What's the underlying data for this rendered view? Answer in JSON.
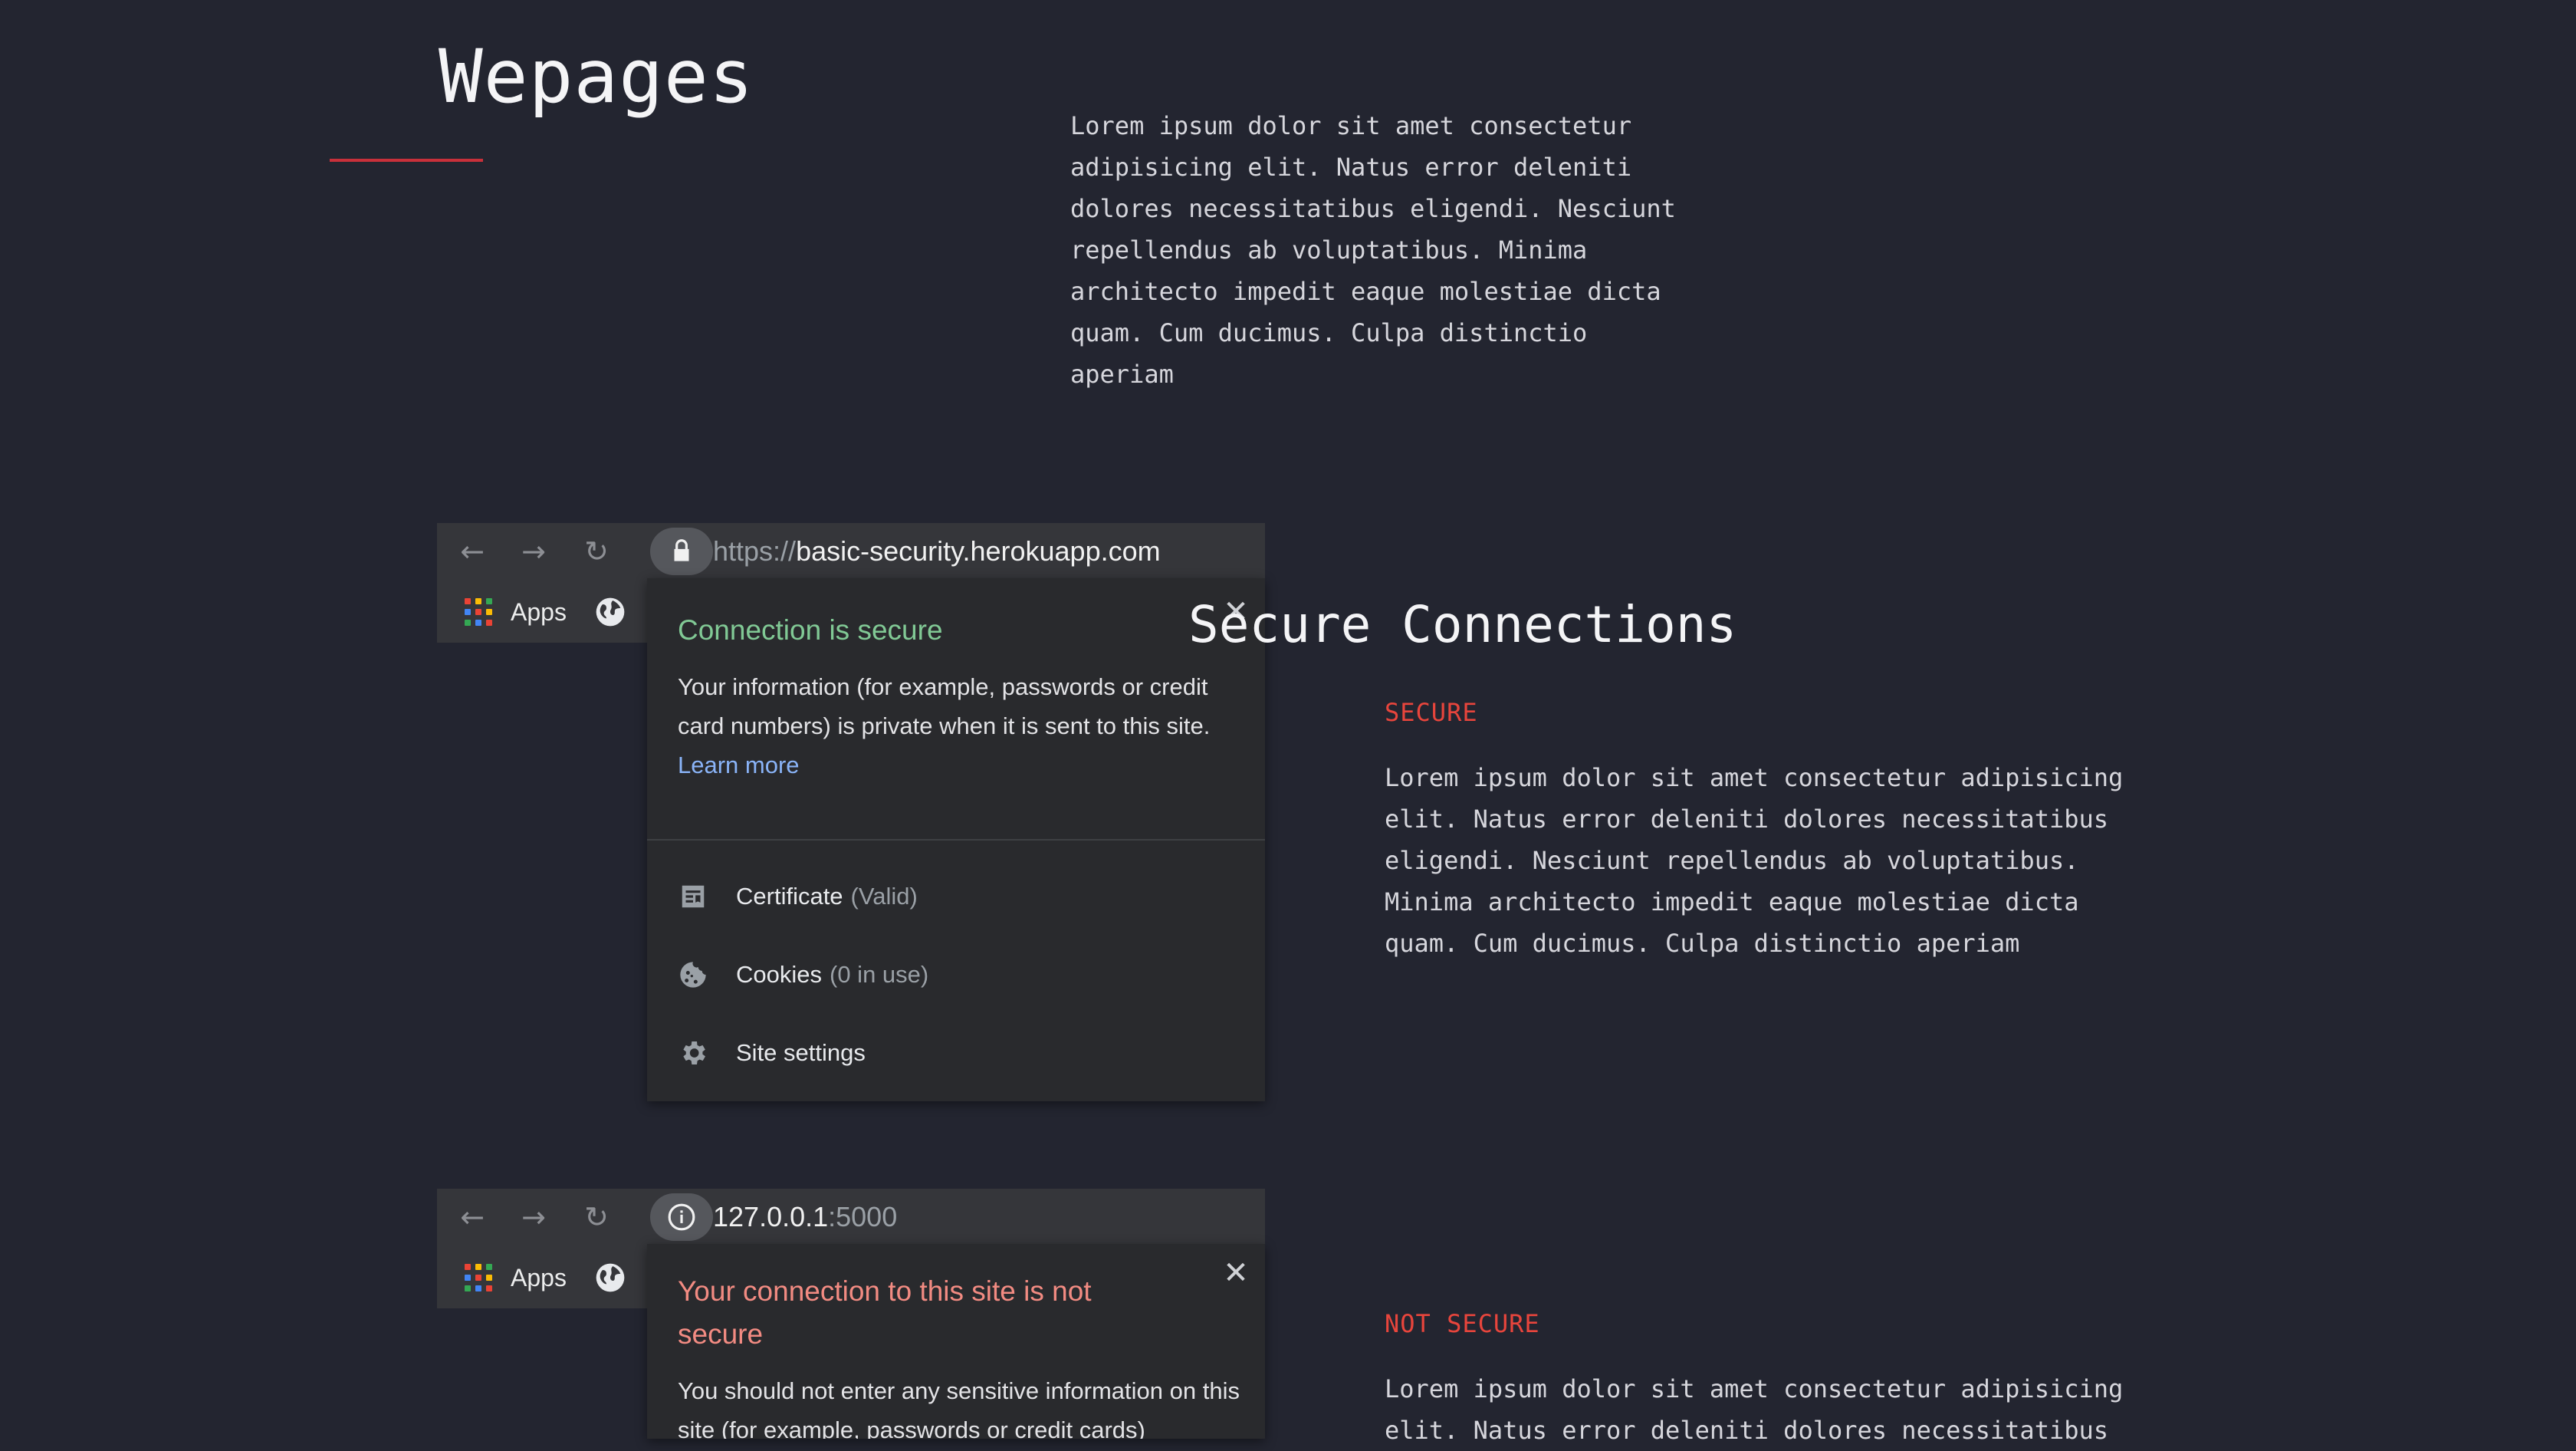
{
  "header": {
    "title": "Wepages",
    "intro": "Lorem ipsum dolor sit amet consectetur adipisicing elit. Natus error deleniti dolores necessitatibus eligendi. Nesciunt repellendus ab voluptatibus. Minima architecto impedit eaque molestiae dicta quam. Cum ducimus. Culpa distinctio aperiam"
  },
  "browser": {
    "back_glyph": "←",
    "forward_glyph": "→",
    "reload_glyph": "↻",
    "apps_label": "Apps",
    "icons": [
      "back-icon",
      "forward-icon",
      "reload-icon",
      "lock-icon",
      "info-icon",
      "apps-grid-icon",
      "globe-icon",
      "close-icon",
      "certificate-icon",
      "cookie-icon",
      "gear-icon"
    ]
  },
  "secure_example": {
    "url_scheme": "https://",
    "url_host": "basic-security.herokuapp.com",
    "popup_title": "Connection is secure",
    "popup_body": "Your information (for example, passwords or credit card numbers) is private when it is sent to this site.",
    "learn_more": "Learn more",
    "rows": [
      {
        "label": "Certificate",
        "detail": "(Valid)"
      },
      {
        "label": "Cookies",
        "detail": "(0 in use)"
      },
      {
        "label": "Site settings",
        "detail": ""
      }
    ],
    "close_glyph": "✕"
  },
  "insecure_example": {
    "url_host": "127.0.0.1",
    "url_port": ":5000",
    "popup_title": "Your connection to this site is not secure",
    "popup_body": "You should not enter any sensitive information on this site (for example, passwords or credit cards)",
    "close_glyph": "✕"
  },
  "section": {
    "title": "Secure Connections",
    "secure_label": "SECURE",
    "secure_text": "Lorem ipsum dolor sit amet consectetur adipisicing elit. Natus error deleniti dolores necessitatibus eligendi. Nesciunt repellendus ab voluptatibus. Minima architecto impedit eaque molestiae dicta quam. Cum ducimus. Culpa distinctio aperiam",
    "not_secure_label": "NOT SECURE",
    "not_secure_text": "Lorem ipsum dolor sit amet consectetur adipisicing elit. Natus error deleniti dolores necessitatibus"
  },
  "colors": {
    "background": "#232530",
    "accent_red": "#e8453c",
    "secure_green": "#81c995",
    "insecure_red": "#f28b82",
    "link_blue": "#8ab4f8"
  }
}
